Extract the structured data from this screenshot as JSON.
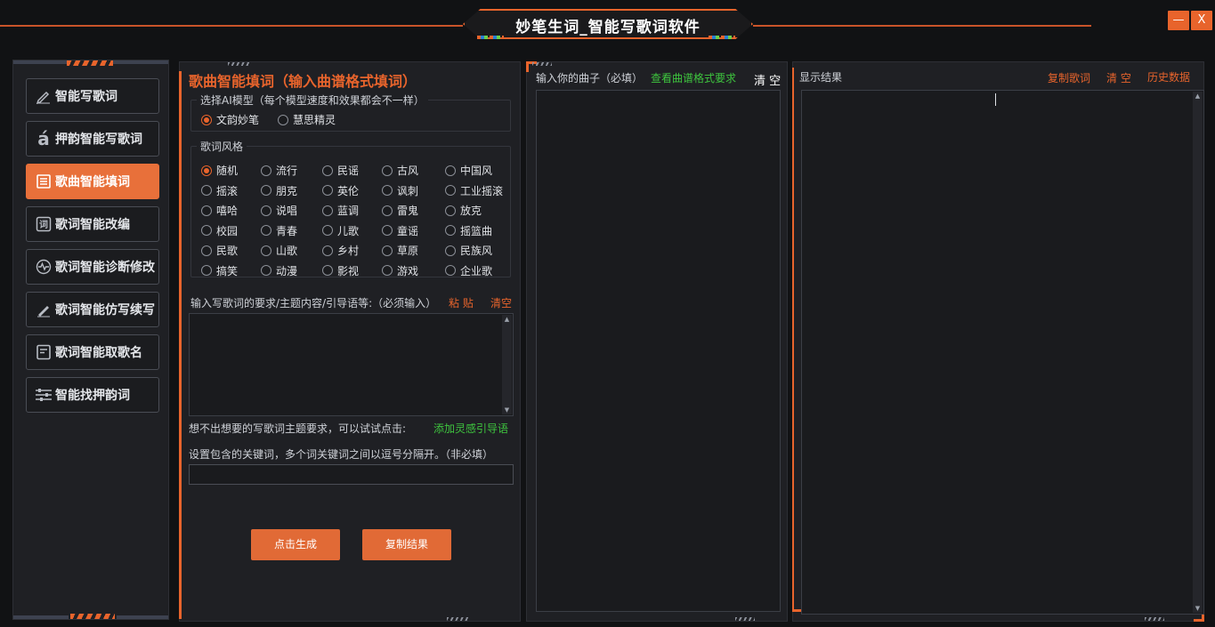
{
  "window": {
    "title": "妙笔生词_智能写歌词软件",
    "minimize_label": "—",
    "close_label": "X"
  },
  "colors": {
    "accent": "#e8642c",
    "green_link": "#3ec43e",
    "bg": "#111214",
    "panel": "#1f2024"
  },
  "sidebar": {
    "items": [
      {
        "label": "智能写歌词",
        "icon": "pen-icon",
        "active": false
      },
      {
        "label": "押韵智能写歌词",
        "icon": "rhyme-a-icon",
        "active": false
      },
      {
        "label": "歌曲智能填词",
        "icon": "list-icon",
        "active": true
      },
      {
        "label": "歌词智能改编",
        "icon": "ci-char-icon",
        "active": false
      },
      {
        "label": "歌词智能诊断修改",
        "icon": "pulse-icon",
        "active": false
      },
      {
        "label": "歌词智能仿写续写",
        "icon": "pencil-icon",
        "active": false
      },
      {
        "label": "歌词智能取歌名",
        "icon": "document-icon",
        "active": false
      },
      {
        "label": "智能找押韵词",
        "icon": "sliders-icon",
        "active": false
      }
    ]
  },
  "form": {
    "title": "歌曲智能填词（输入曲谱格式填词）",
    "model_legend": "选择AI模型（每个模型速度和效果都会不一样）",
    "models": [
      {
        "label": "文韵妙笔",
        "selected": true
      },
      {
        "label": "慧思精灵",
        "selected": false
      }
    ],
    "style_legend": "歌词风格",
    "styles": [
      [
        "随机",
        "流行",
        "民谣",
        "古风",
        "中国风"
      ],
      [
        "摇滚",
        "朋克",
        "英伦",
        "讽刺",
        "工业摇滚"
      ],
      [
        "嘻哈",
        "说唱",
        "蓝调",
        "雷鬼",
        "放克"
      ],
      [
        "校园",
        "青春",
        "儿歌",
        "童谣",
        "摇篮曲"
      ],
      [
        "民歌",
        "山歌",
        "乡村",
        "草原",
        "民族风"
      ],
      [
        "搞笑",
        "动漫",
        "影视",
        "游戏",
        "企业歌"
      ]
    ],
    "selected_style": "随机",
    "requirement_label": "输入写歌词的要求/主题内容/引导语等:（必须输入）",
    "paste_label": "粘 贴",
    "clear_label": "清空",
    "hint_label": "想不出想要的写歌词主题要求，可以试试点击:",
    "inspire_link": "添加灵感引导语",
    "keywords_label": "设置包含的关键词，多个词关键词之间以逗号分隔开。（非必填）",
    "keywords_value": "",
    "generate_button": "点击生成",
    "copy_button": "复制结果"
  },
  "melody": {
    "label": "输入你的曲子（必填）",
    "format_link": "查看曲谱格式要求",
    "clear_label": "清 空",
    "value": ""
  },
  "result": {
    "label": "显示结果",
    "copy_link": "复制歌词",
    "clear_link": "清 空",
    "history_link": "历史数据",
    "value": ""
  }
}
